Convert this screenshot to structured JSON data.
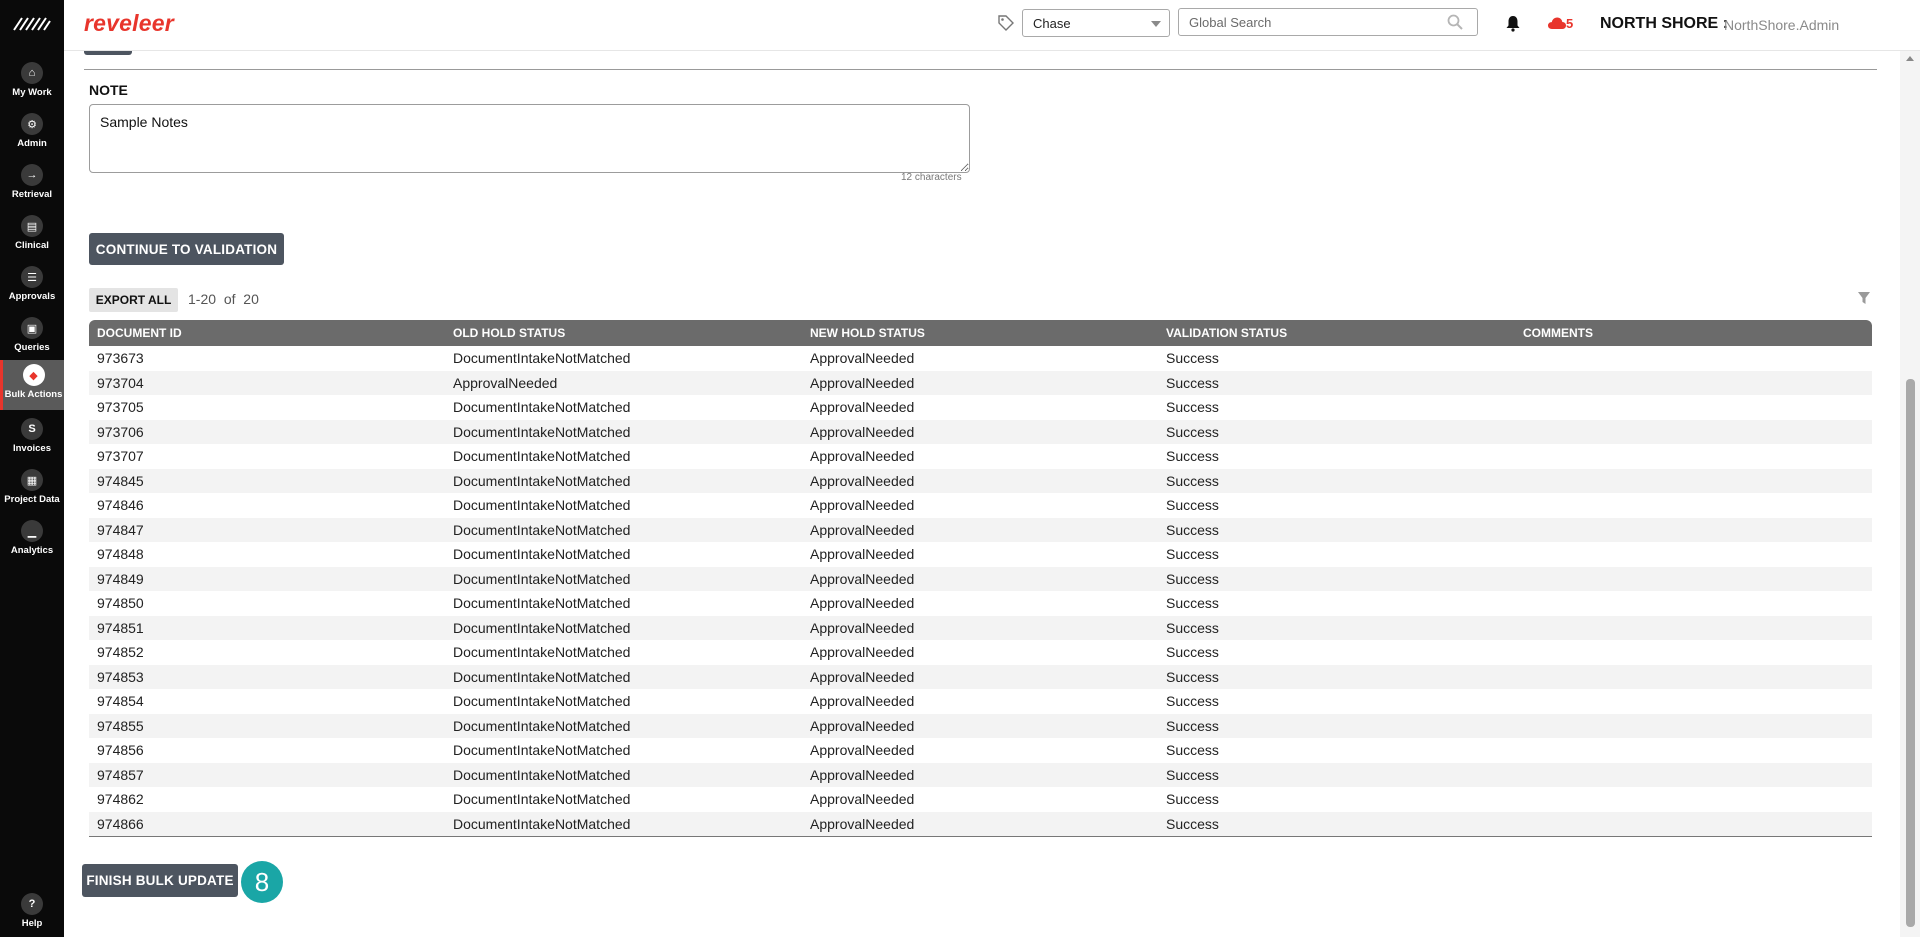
{
  "app": {
    "brand": "reveleer"
  },
  "sidebar": {
    "items": [
      {
        "label": "My Work",
        "glyph": "⌂"
      },
      {
        "label": "Admin",
        "glyph": "⚙"
      },
      {
        "label": "Retrieval",
        "glyph": "→"
      },
      {
        "label": "Clinical",
        "glyph": "▤"
      },
      {
        "label": "Approvals",
        "glyph": "☰"
      },
      {
        "label": "Queries",
        "glyph": "▣"
      },
      {
        "label": "Bulk Actions",
        "glyph": "◆"
      },
      {
        "label": "Invoices",
        "glyph": "S"
      },
      {
        "label": "Project Data",
        "glyph": "▦"
      },
      {
        "label": "Analytics",
        "glyph": "▁"
      }
    ],
    "help": {
      "label": "Help",
      "glyph": "?"
    }
  },
  "header": {
    "project_select": "Chase",
    "search_placeholder": "Global Search",
    "cloud_count": "5",
    "org": "NORTH SHORE",
    "org_separator": ":",
    "user": "NorthShore.Admin"
  },
  "note": {
    "label": "NOTE",
    "value": "Sample Notes",
    "char_count": "12 characters"
  },
  "actions": {
    "continue_label": "CONTINUE TO VALIDATION",
    "export_label": "EXPORT ALL",
    "pager_range": "1-20",
    "pager_of": "of",
    "pager_total": "20",
    "finish_label": "FINISH BULK UPDATE",
    "step_number": "8"
  },
  "table": {
    "headers": [
      "DOCUMENT ID",
      "OLD HOLD STATUS",
      "NEW HOLD STATUS",
      "VALIDATION STATUS",
      "COMMENTS"
    ],
    "rows": [
      [
        "973673",
        "DocumentIntakeNotMatched",
        "ApprovalNeeded",
        "Success",
        ""
      ],
      [
        "973704",
        "ApprovalNeeded",
        "ApprovalNeeded",
        "Success",
        ""
      ],
      [
        "973705",
        "DocumentIntakeNotMatched",
        "ApprovalNeeded",
        "Success",
        ""
      ],
      [
        "973706",
        "DocumentIntakeNotMatched",
        "ApprovalNeeded",
        "Success",
        ""
      ],
      [
        "973707",
        "DocumentIntakeNotMatched",
        "ApprovalNeeded",
        "Success",
        ""
      ],
      [
        "974845",
        "DocumentIntakeNotMatched",
        "ApprovalNeeded",
        "Success",
        ""
      ],
      [
        "974846",
        "DocumentIntakeNotMatched",
        "ApprovalNeeded",
        "Success",
        ""
      ],
      [
        "974847",
        "DocumentIntakeNotMatched",
        "ApprovalNeeded",
        "Success",
        ""
      ],
      [
        "974848",
        "DocumentIntakeNotMatched",
        "ApprovalNeeded",
        "Success",
        ""
      ],
      [
        "974849",
        "DocumentIntakeNotMatched",
        "ApprovalNeeded",
        "Success",
        ""
      ],
      [
        "974850",
        "DocumentIntakeNotMatched",
        "ApprovalNeeded",
        "Success",
        ""
      ],
      [
        "974851",
        "DocumentIntakeNotMatched",
        "ApprovalNeeded",
        "Success",
        ""
      ],
      [
        "974852",
        "DocumentIntakeNotMatched",
        "ApprovalNeeded",
        "Success",
        ""
      ],
      [
        "974853",
        "DocumentIntakeNotMatched",
        "ApprovalNeeded",
        "Success",
        ""
      ],
      [
        "974854",
        "DocumentIntakeNotMatched",
        "ApprovalNeeded",
        "Success",
        ""
      ],
      [
        "974855",
        "DocumentIntakeNotMatched",
        "ApprovalNeeded",
        "Success",
        ""
      ],
      [
        "974856",
        "DocumentIntakeNotMatched",
        "ApprovalNeeded",
        "Success",
        ""
      ],
      [
        "974857",
        "DocumentIntakeNotMatched",
        "ApprovalNeeded",
        "Success",
        ""
      ],
      [
        "974862",
        "DocumentIntakeNotMatched",
        "ApprovalNeeded",
        "Success",
        ""
      ],
      [
        "974866",
        "DocumentIntakeNotMatched",
        "ApprovalNeeded",
        "Success",
        ""
      ]
    ]
  },
  "colors": {
    "brand": "#e8352c",
    "sidebar_bg": "#0a0a0a",
    "button_dark": "#4d5560",
    "table_header": "#6b6b6b",
    "step_badge": "#1aa6a6"
  }
}
